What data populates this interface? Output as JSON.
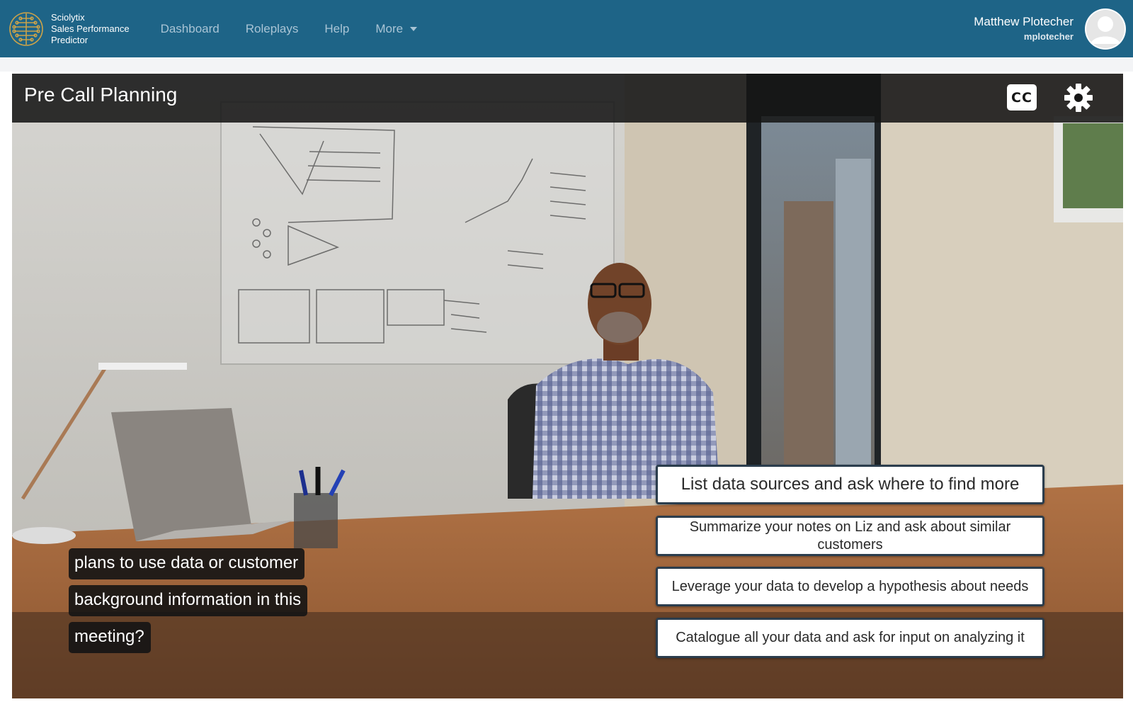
{
  "brand": {
    "line1": "Sciolytix",
    "line2": "Sales Performance",
    "line3": "Predictor",
    "logo_icon": "brain-circuit-icon"
  },
  "nav": {
    "items": [
      {
        "label": "Dashboard"
      },
      {
        "label": "Roleplays"
      },
      {
        "label": "Help"
      },
      {
        "label": "More"
      }
    ]
  },
  "user": {
    "name": "Matthew Plotecher",
    "handle": "mplotecher",
    "avatar_icon": "user-avatar-icon"
  },
  "scene": {
    "title": "Pre Call Planning",
    "cc_label": "CC",
    "settings_icon": "gear-icon"
  },
  "caption": {
    "lines": [
      "plans to use data or customer",
      "background information in this",
      "meeting?"
    ]
  },
  "options": [
    {
      "label": "List data sources and ask where to find more"
    },
    {
      "label": "Summarize your notes on Liz and ask about similar customers"
    },
    {
      "label": "Leverage your data to develop a hypothesis about needs"
    },
    {
      "label": "Catalogue all your data and ask for input on analyzing it"
    }
  ],
  "colors": {
    "navbar": "#1e6487",
    "nav_link": "#a9c4d5",
    "title_bar": "#161616",
    "option_border": "#2b3d4d"
  }
}
